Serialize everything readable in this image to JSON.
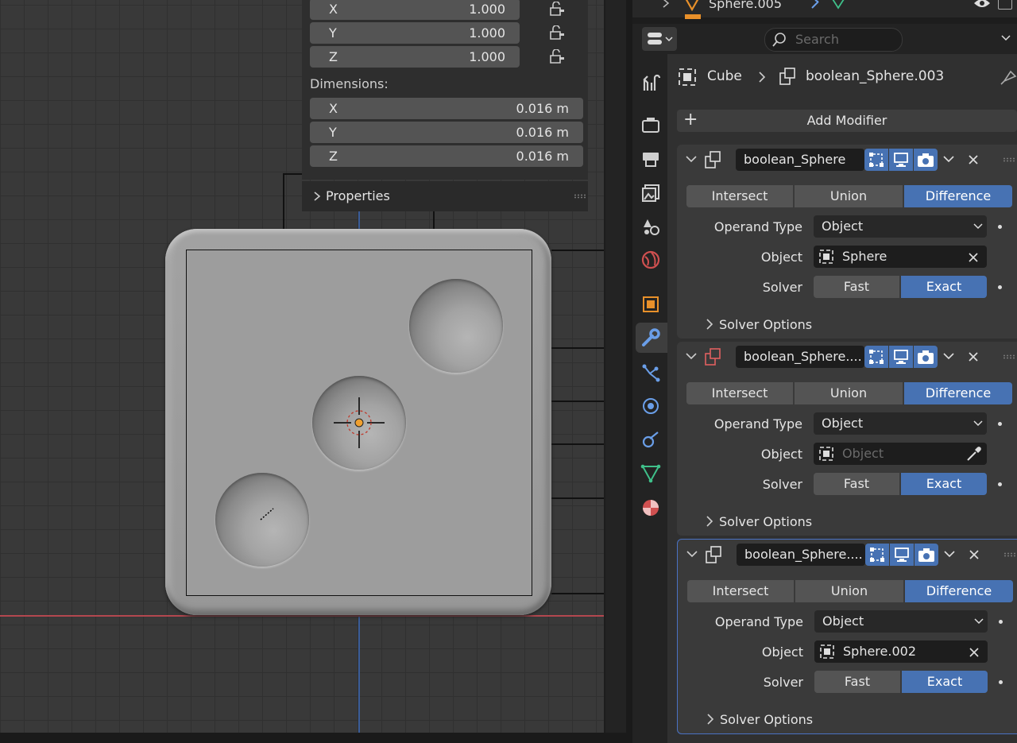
{
  "outliner": {
    "item_label": "Sphere.005"
  },
  "npanel": {
    "scale_rows": [
      {
        "axis": "X",
        "value": "1.000"
      },
      {
        "axis": "Y",
        "value": "1.000"
      },
      {
        "axis": "Z",
        "value": "1.000"
      }
    ],
    "dimensions_title": "Dimensions:",
    "dimension_rows": [
      {
        "axis": "X",
        "value": "0.016 m"
      },
      {
        "axis": "Y",
        "value": "0.016 m"
      },
      {
        "axis": "Z",
        "value": "0.016 m"
      }
    ],
    "properties_label": "Properties"
  },
  "properties": {
    "search_placeholder": "Search",
    "breadcrumb": {
      "object": "Cube",
      "modifier": "boolean_Sphere.003"
    },
    "add_modifier_label": "Add Modifier",
    "tabs": [
      {
        "name": "tool-tab",
        "icon": "wrench-screwdriver-icon",
        "color": "#cfcfcf"
      },
      {
        "name": "render-tab",
        "icon": "camera-back-icon",
        "color": "#cfcfcf"
      },
      {
        "name": "output-tab",
        "icon": "printer-icon",
        "color": "#cfcfcf"
      },
      {
        "name": "view-layer-tab",
        "icon": "image-stack-icon",
        "color": "#cfcfcf"
      },
      {
        "name": "scene-tab",
        "icon": "scene-shapes-icon",
        "color": "#cfcfcf"
      },
      {
        "name": "world-tab",
        "icon": "globe-icon",
        "color": "#d05050"
      },
      {
        "name": "object-tab",
        "icon": "object-square-icon",
        "color": "#e8902a"
      },
      {
        "name": "modifier-tab",
        "icon": "wrench-icon",
        "color": "#6a9ee8"
      },
      {
        "name": "particles-tab",
        "icon": "particles-icon",
        "color": "#6a9ee8"
      },
      {
        "name": "physics-tab",
        "icon": "physics-orbit-icon",
        "color": "#6a9ee8"
      },
      {
        "name": "constraints-tab",
        "icon": "constraint-icon",
        "color": "#6a9ee8"
      },
      {
        "name": "data-tab",
        "icon": "mesh-data-icon",
        "color": "#3fc08a"
      },
      {
        "name": "material-tab",
        "icon": "material-sphere-icon",
        "color": "#d05050"
      }
    ],
    "modifiers": [
      {
        "name": "boolean_Sphere",
        "operations": [
          "Intersect",
          "Union",
          "Difference"
        ],
        "selected_operation": "Difference",
        "operand_type_label": "Operand Type",
        "operand_type_value": "Object",
        "object_label": "Object",
        "object_value": "Sphere",
        "solver_label": "Solver",
        "solver_options": [
          "Fast",
          "Exact"
        ],
        "selected_solver": "Exact",
        "solver_options_label": "Solver Options"
      },
      {
        "name": "boolean_Sphere....",
        "operations": [
          "Intersect",
          "Union",
          "Difference"
        ],
        "selected_operation": "Difference",
        "operand_type_label": "Operand Type",
        "operand_type_value": "Object",
        "object_label": "Object",
        "object_placeholder": "Object",
        "solver_label": "Solver",
        "solver_options": [
          "Fast",
          "Exact"
        ],
        "selected_solver": "Exact",
        "solver_options_label": "Solver Options"
      },
      {
        "name": "boolean_Sphere....",
        "operations": [
          "Intersect",
          "Union",
          "Difference"
        ],
        "selected_operation": "Difference",
        "operand_type_label": "Operand Type",
        "operand_type_value": "Object",
        "object_label": "Object",
        "object_value": "Sphere.002",
        "solver_label": "Solver",
        "solver_options": [
          "Fast",
          "Exact"
        ],
        "selected_solver": "Exact",
        "solver_options_label": "Solver Options"
      }
    ]
  },
  "colors": {
    "accent_blue": "#4772b3",
    "x_axis": "#b3474f",
    "y_axis": "#3b5d99",
    "cursor_orange": "#f0a030"
  }
}
